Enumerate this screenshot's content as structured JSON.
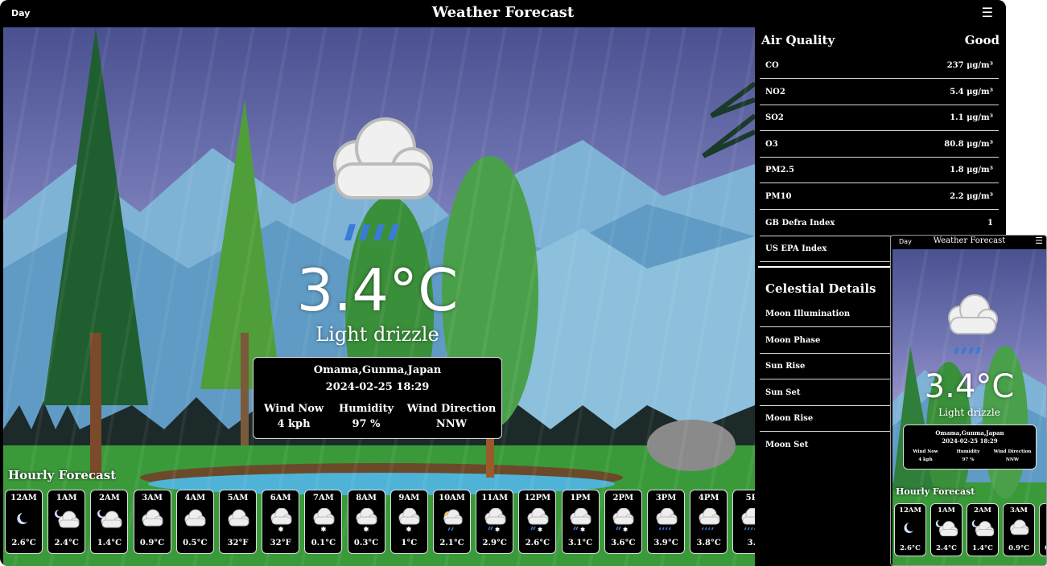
{
  "header": {
    "day_label": "Day",
    "title": "Weather Forecast",
    "menu_icon": "hamburger-menu-icon"
  },
  "current": {
    "temperature": "3.4°C",
    "condition": "Light drizzle",
    "location": "Omama,Gunma,Japan",
    "datetime": "2024-02-25 18:29",
    "stats": [
      {
        "label": "Wind Now",
        "value": "4 kph"
      },
      {
        "label": "Humidity",
        "value": "97 %"
      },
      {
        "label": "Wind Direction",
        "value": "NNW"
      }
    ]
  },
  "air_quality": {
    "title": "Air Quality",
    "rating": "Good",
    "rows": [
      {
        "label": "CO",
        "value": "237 μg/m³"
      },
      {
        "label": "NO2",
        "value": "5.4 μg/m³"
      },
      {
        "label": "SO2",
        "value": "1.1 μg/m³"
      },
      {
        "label": "O3",
        "value": "80.8 μg/m³"
      },
      {
        "label": "PM2.5",
        "value": "1.8 μg/m³"
      },
      {
        "label": "PM10",
        "value": "2.2 μg/m³"
      },
      {
        "label": "GB Defra Index",
        "value": "1"
      },
      {
        "label": "US EPA Index",
        "value": ""
      }
    ]
  },
  "celestial": {
    "title": "Celestial Details",
    "rows": [
      "Moon Illumination",
      "Moon Phase",
      "Sun Rise",
      "Sun Set",
      "Moon Rise",
      "Moon Set"
    ]
  },
  "hourly": {
    "title": "Hourly Forecast",
    "items": [
      {
        "time": "12AM",
        "temp": "2.6°C",
        "icon": "moon-icon"
      },
      {
        "time": "1AM",
        "temp": "2.4°C",
        "icon": "moon-cloud-icon"
      },
      {
        "time": "2AM",
        "temp": "1.4°C",
        "icon": "moon-cloud-icon"
      },
      {
        "time": "3AM",
        "temp": "0.9°C",
        "icon": "cloud-icon"
      },
      {
        "time": "4AM",
        "temp": "0.5°C",
        "icon": "cloud-icon"
      },
      {
        "time": "5AM",
        "temp": "32°F",
        "icon": "cloud-icon"
      },
      {
        "time": "6AM",
        "temp": "32°F",
        "icon": "cloud-snow-icon"
      },
      {
        "time": "7AM",
        "temp": "0.1°C",
        "icon": "cloud-snow-icon"
      },
      {
        "time": "8AM",
        "temp": "0.3°C",
        "icon": "cloud-snow-icon"
      },
      {
        "time": "9AM",
        "temp": "1°C",
        "icon": "cloud-snow-icon"
      },
      {
        "time": "10AM",
        "temp": "2.1°C",
        "icon": "sun-cloud-rain-icon"
      },
      {
        "time": "11AM",
        "temp": "2.9°C",
        "icon": "cloud-sleet-icon"
      },
      {
        "time": "12PM",
        "temp": "2.6°C",
        "icon": "cloud-sleet-icon"
      },
      {
        "time": "1PM",
        "temp": "3.1°C",
        "icon": "cloud-sleet-icon"
      },
      {
        "time": "2PM",
        "temp": "3.6°C",
        "icon": "cloud-sleet-icon"
      },
      {
        "time": "3PM",
        "temp": "3.9°C",
        "icon": "cloud-rain-icon"
      },
      {
        "time": "4PM",
        "temp": "3.8°C",
        "icon": "cloud-rain-icon"
      },
      {
        "time": "5P",
        "temp": "3.",
        "icon": "cloud-rain-icon"
      }
    ]
  },
  "mobile_hourly_count": 5,
  "colors": {
    "background": "#000000",
    "text": "#ffffff",
    "rain_blue": "#3a7bd5",
    "sky_top": "#4a5190"
  }
}
